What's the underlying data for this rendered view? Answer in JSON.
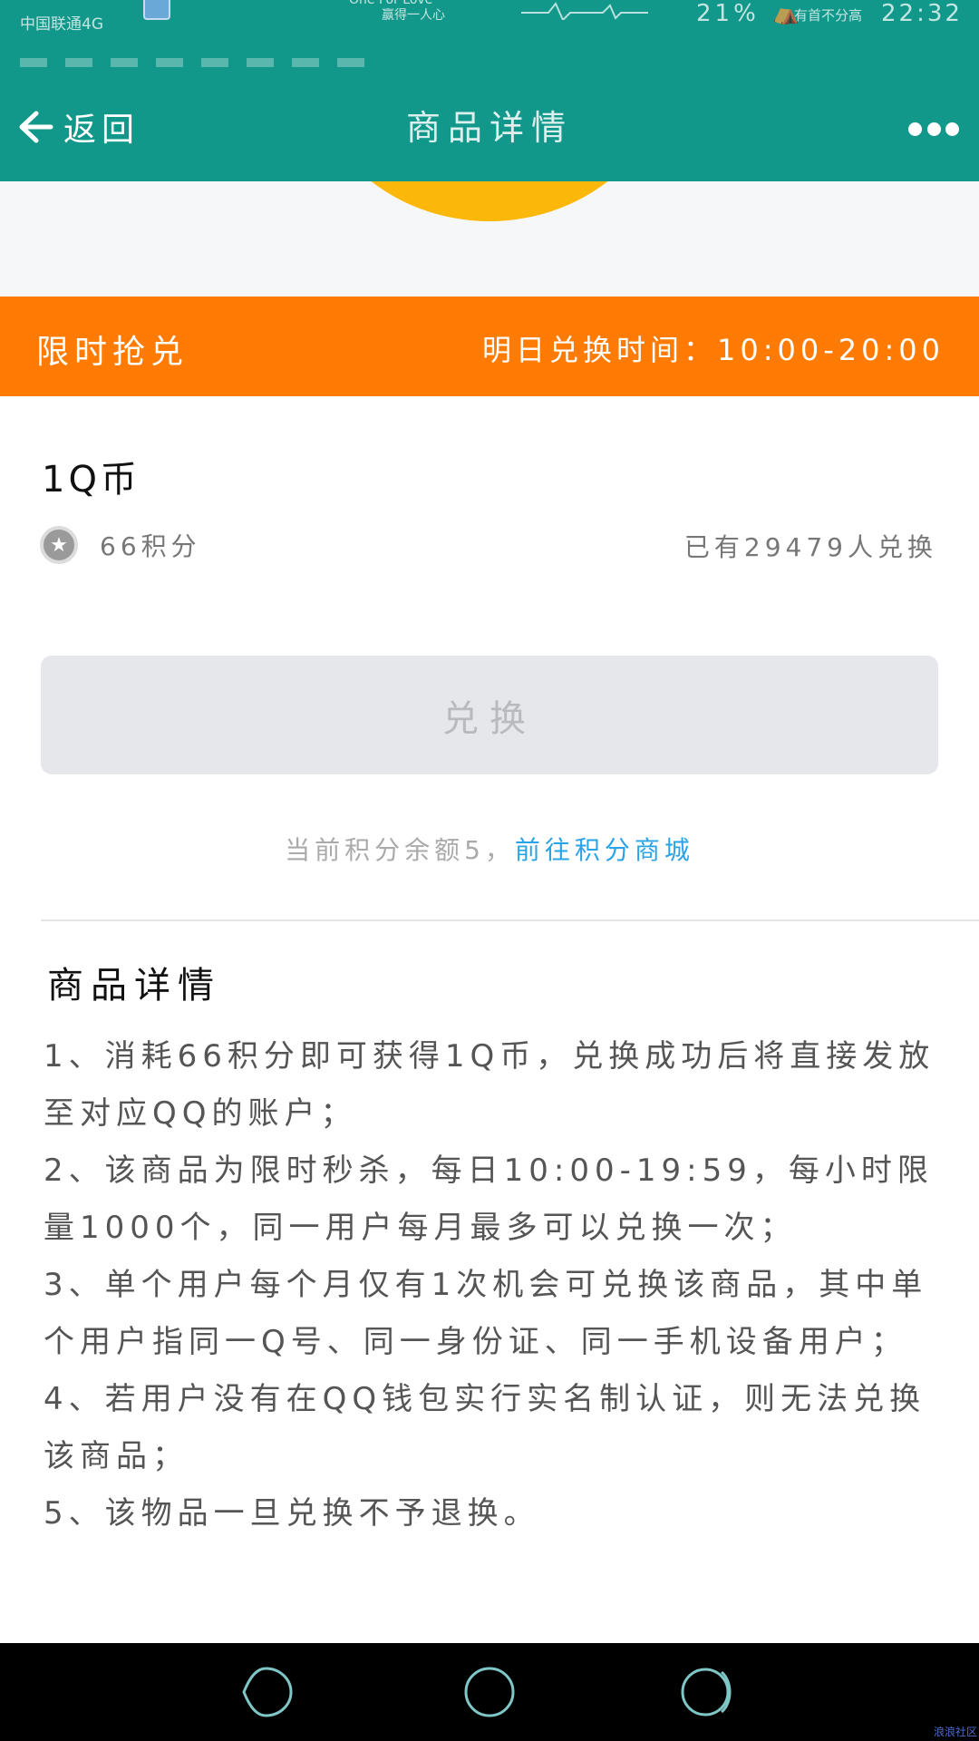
{
  "status_bar": {
    "carrier": "中国联通4G",
    "music_line1": "One For Love",
    "music_line2": "赢得一人心",
    "battery": "21%",
    "note": "有首不分高",
    "time": "22:32"
  },
  "header": {
    "back_label": "返回",
    "title": "商品详情"
  },
  "flash_sale": {
    "label": "限时抢兑",
    "time_text": "明日兑换时间：10:00-20:00"
  },
  "product": {
    "name": "1Q币",
    "points": "66积分",
    "redeemed_count": "已有29479人兑换"
  },
  "redeem_button": {
    "label": "兑换"
  },
  "balance": {
    "text": "当前积分余额5，",
    "link": "前往积分商城"
  },
  "details": {
    "title": "商品详情",
    "items": [
      "1、消耗66积分即可获得1Q币，兑换成功后将直接发放至对应QQ的账户；",
      "2、该商品为限时秒杀，每日10:00-19:59，每小时限量1000个，同一用户每月最多可以兑换一次；",
      "3、单个用户每个月仅有1次机会可兑换该商品，其中单个用户指同一Q号、同一身份证、同一手机设备用户；",
      "4、若用户没有在QQ钱包实行实名制认证，则无法兑换该商品；",
      "5、该物品一旦兑换不予退换。"
    ]
  },
  "watermark": "浪浪社区",
  "colors": {
    "header_teal": "#12988a",
    "flash_orange": "#ff7b04",
    "coin_yellow": "#fbb80b",
    "link_blue": "#2aa4e6"
  }
}
